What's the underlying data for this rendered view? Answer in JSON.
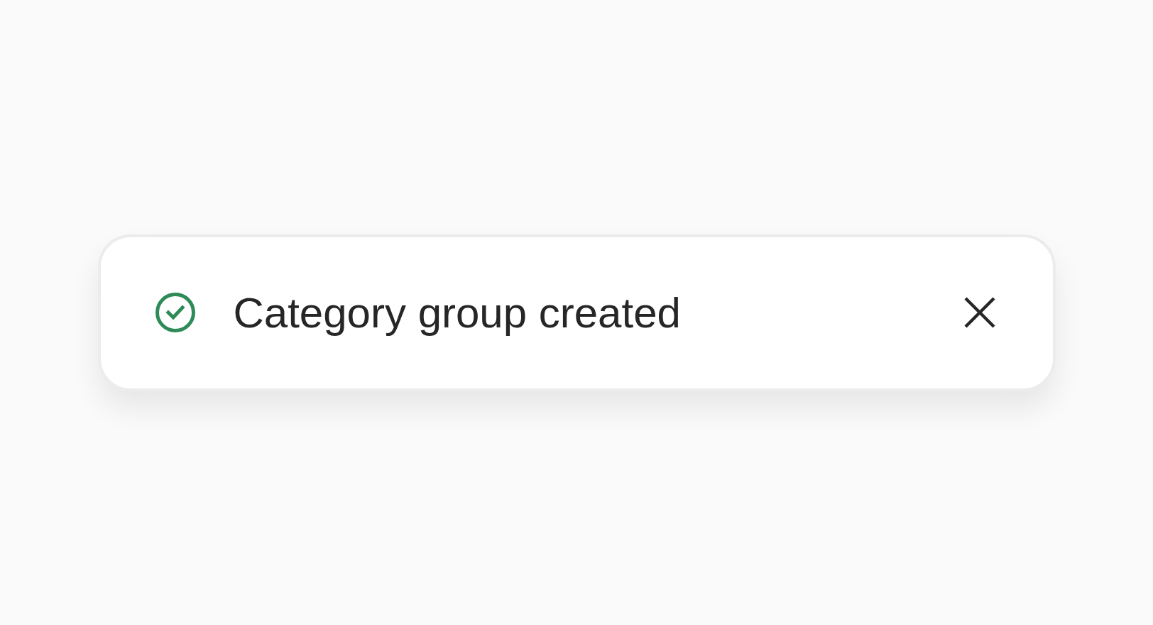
{
  "toast": {
    "kind": "success",
    "message": "Category group created"
  }
}
